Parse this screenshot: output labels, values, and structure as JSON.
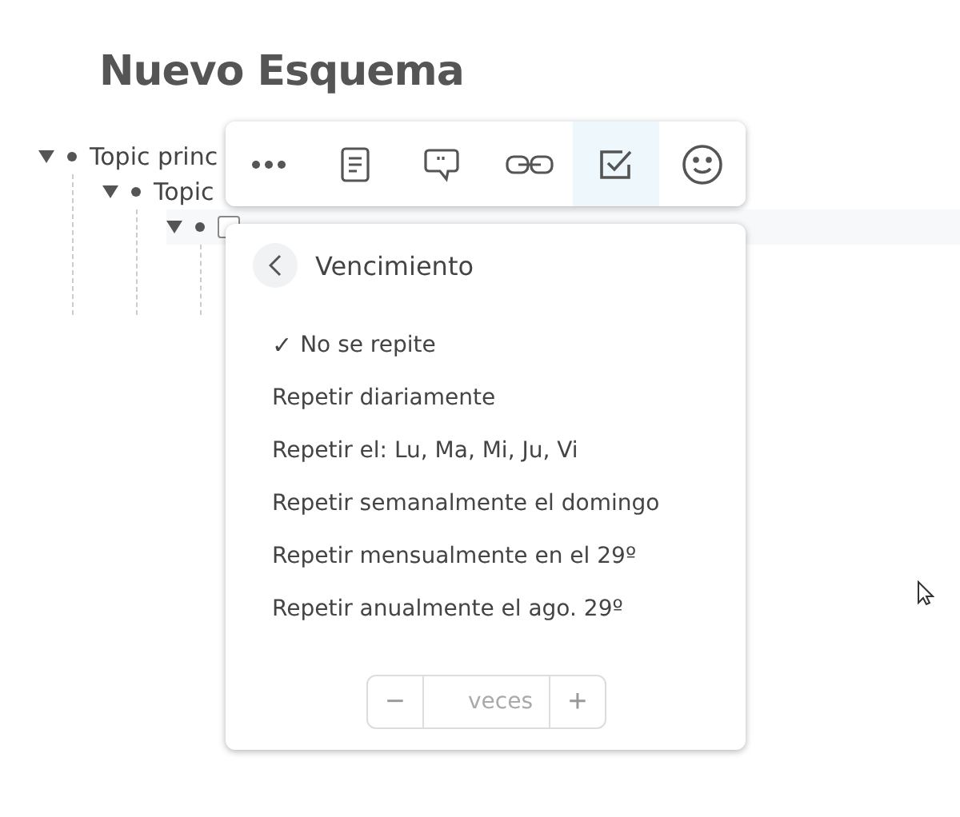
{
  "title": "Nuevo Esquema",
  "outline": [
    {
      "label": "Topic princ",
      "expanded": true,
      "children": [
        {
          "label": "Topic",
          "expanded": true,
          "children": [
            {
              "kind": "task",
              "checked": false,
              "expanded": true,
              "highlighted": true
            }
          ]
        }
      ]
    }
  ],
  "toolbar": [
    {
      "kind": "more",
      "selected": false
    },
    {
      "kind": "note",
      "selected": false
    },
    {
      "kind": "comment",
      "selected": false
    },
    {
      "kind": "link",
      "selected": false
    },
    {
      "kind": "task",
      "selected": true
    },
    {
      "kind": "emoji",
      "selected": false
    }
  ],
  "due_menu": {
    "title": "Vencimiento",
    "options": [
      {
        "label": "No se repite",
        "selected": true
      },
      {
        "label": "Repetir diariamente",
        "selected": false
      },
      {
        "label": "Repetir el: Lu, Ma, Mi, Ju, Vi",
        "selected": false
      },
      {
        "label": "Repetir semanalmente el domingo",
        "selected": false
      },
      {
        "label": "Repetir mensualmente en el 29º",
        "selected": false
      },
      {
        "label": "Repetir anualmente el ago. 29º",
        "selected": false
      }
    ],
    "check_mark": "✓",
    "stepper": {
      "decrement": "−",
      "placeholder": "veces",
      "increment": "+"
    }
  }
}
